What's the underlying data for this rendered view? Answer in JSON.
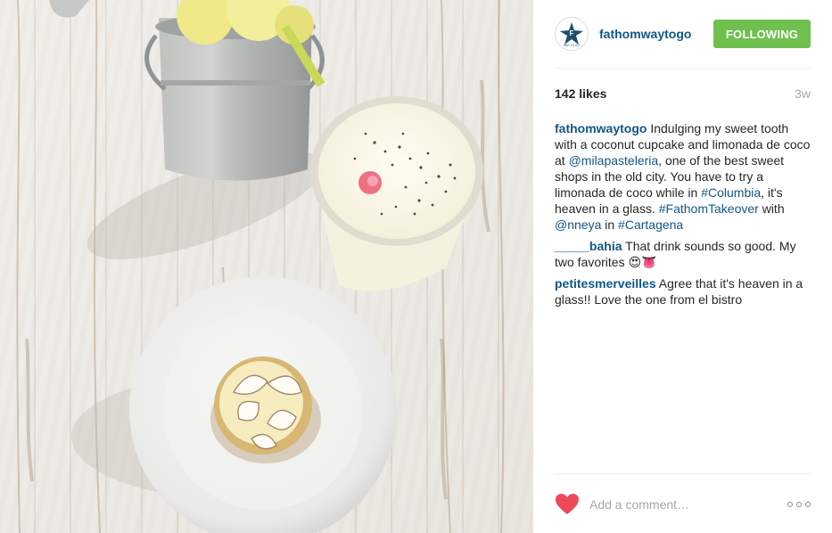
{
  "post": {
    "username": "fathomwaytogo",
    "avatar_text": "WAY TO GO",
    "follow_label": "FOLLOWING",
    "likes": "142 likes",
    "time_ago": "3w"
  },
  "caption": {
    "user": "fathomwaytogo",
    "parts": [
      " Indulging my sweet tooth with a coconut cupcake and limonada de coco at ",
      "@milapasteleria",
      ", one of the best sweet shops in the old city. You have to try a limonada de coco while in ",
      "#Columbia",
      ", it's heaven in a glass. ",
      "#FathomTakeover",
      " with ",
      "@nneya",
      " in ",
      "#Cartagena"
    ]
  },
  "comments": [
    {
      "user": "_____bahia",
      "text": " That drink sounds so good. My two favorites 😍👅"
    },
    {
      "user": "petitesmerveilles",
      "text": " Agree that it's heaven in a glass!! Love the one from el bistro"
    }
  ],
  "footer": {
    "comment_placeholder": "Add a comment…"
  },
  "colors": {
    "link": "#125688",
    "follow_button": "#70c050",
    "heart": "#ed4956",
    "muted": "#a5a7aa"
  },
  "icons": [
    "heart-icon",
    "more-options-icon",
    "fathom-logo-icon"
  ]
}
